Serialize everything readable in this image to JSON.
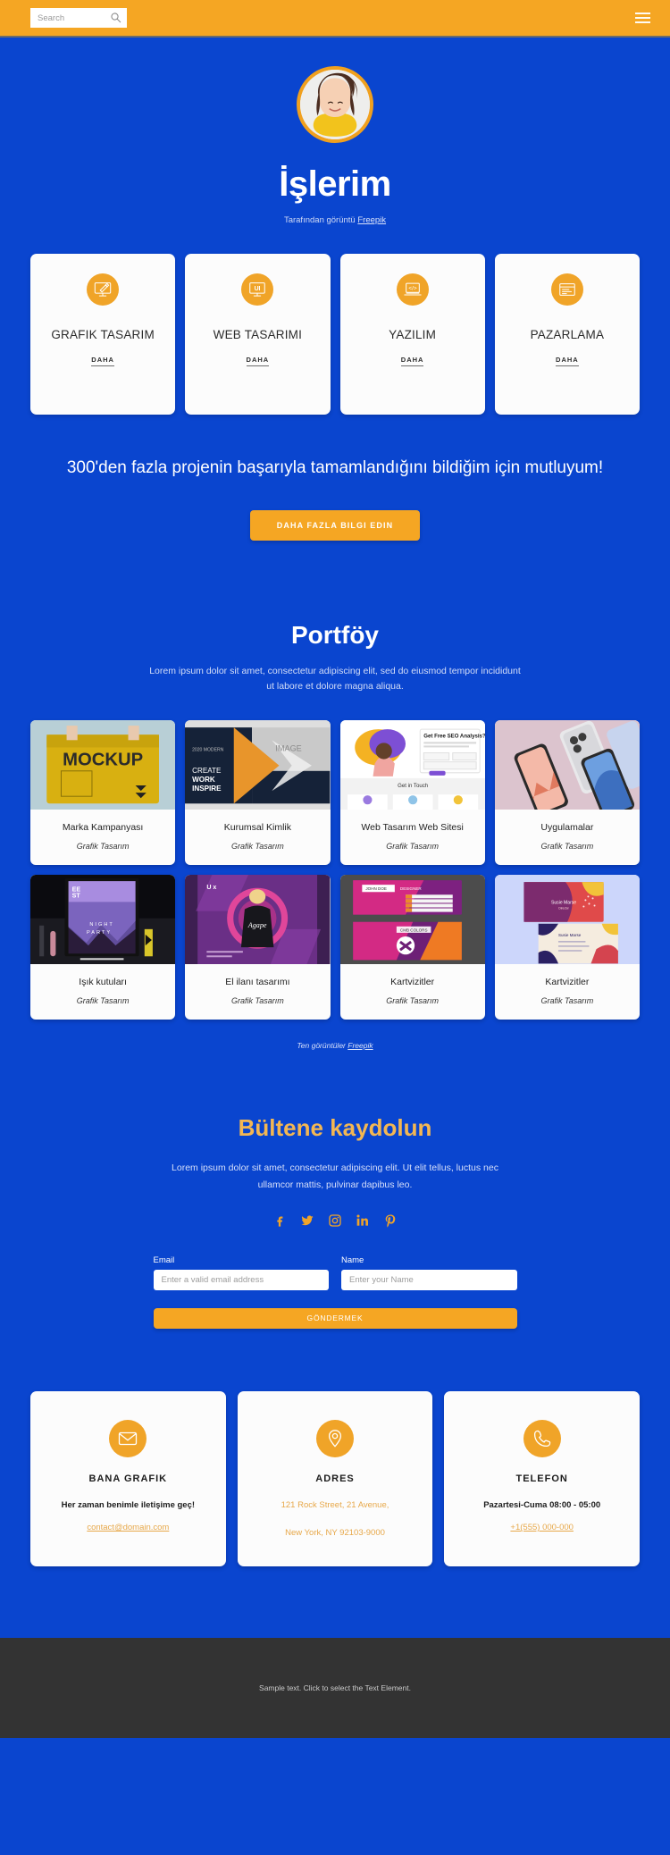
{
  "colors": {
    "brand_blue": "#0a45cf",
    "accent_orange": "#f0a428",
    "topbar_orange": "#f5a623",
    "footer_gray": "#333333",
    "newsletter_title": "#f3b753"
  },
  "topbar": {
    "search_placeholder": "Search",
    "search_value": "",
    "search_icon": "search-icon",
    "menu_icon": "hamburger-menu-icon"
  },
  "hero": {
    "avatar_alt": "profile-photo",
    "title": "İşlerim",
    "credit_prefix": "Tarafından görüntü",
    "credit_link": "Freepik"
  },
  "services": [
    {
      "icon": "monitor-brush-icon",
      "title": "GRAFIK TASARIM",
      "more": "DAHA"
    },
    {
      "icon": "monitor-ui-icon",
      "title": "WEB TASARIMI",
      "more": "DAHA"
    },
    {
      "icon": "laptop-code-icon",
      "title": "YAZILIM",
      "more": "DAHA"
    },
    {
      "icon": "browser-window-icon",
      "title": "PAZARLAMA",
      "more": "DAHA"
    }
  ],
  "cta": {
    "headline": "300'den fazla projenin başarıyla tamamlandığını bildiğim için mutluyum!",
    "button": "DAHA FAZLA BILGI EDIN"
  },
  "portfolio": {
    "title": "Portföy",
    "subtitle": "Lorem ipsum dolor sit amet, consectetur adipiscing elit, sed do eiusmod tempor incididunt ut labore et dolore magna aliqua.",
    "items": [
      {
        "name": "Marka Kampanyası",
        "category": "Grafik Tasarım",
        "thumb": "yellow-mockup-bag"
      },
      {
        "name": "Kurumsal Kimlik",
        "category": "Grafik Tasarım",
        "thumb": "corporate-brochure"
      },
      {
        "name": "Web Tasarım Web Sitesi",
        "category": "Grafik Tasarım",
        "thumb": "seo-landing-page"
      },
      {
        "name": "Uygulamalar",
        "category": "Grafik Tasarım",
        "thumb": "phone-mockups"
      },
      {
        "name": "Işık kutuları",
        "category": "Grafik Tasarım",
        "thumb": "night-party-lightbox"
      },
      {
        "name": "El ilanı tasarımı",
        "category": "Grafik Tasarım",
        "thumb": "purple-flyer"
      },
      {
        "name": "Kartvizitler",
        "category": "Grafik Tasarım",
        "thumb": "pink-business-cards"
      },
      {
        "name": "Kartvizitler",
        "category": "Grafik Tasarım",
        "thumb": "abstract-business-cards"
      }
    ],
    "credit_prefix": "Ten görüntüler",
    "credit_link": "Freepik"
  },
  "newsletter": {
    "title": "Bültene kaydolun",
    "subtitle": "Lorem ipsum dolor sit amet, consectetur adipiscing elit. Ut elit tellus, luctus nec ullamcor mattis, pulvinar dapibus leo.",
    "socials": [
      {
        "icon": "facebook-icon",
        "glyph": "f"
      },
      {
        "icon": "twitter-icon",
        "glyph": "t"
      },
      {
        "icon": "instagram-icon",
        "glyph": "i"
      },
      {
        "icon": "linkedin-icon",
        "glyph": "in"
      },
      {
        "icon": "pinterest-icon",
        "glyph": "p"
      }
    ],
    "email_label": "Email",
    "email_placeholder": "Enter a valid email address",
    "email_value": "",
    "name_label": "Name",
    "name_placeholder": "Enter your Name",
    "name_value": "",
    "submit": "GÖNDERMEK"
  },
  "contacts": [
    {
      "icon": "envelope-icon",
      "title": "BANA GRAFIK",
      "line1": "Her zaman benimle iletişime geç!",
      "link": "contact@domain.com"
    },
    {
      "icon": "map-pin-icon",
      "title": "ADRES",
      "line1": "121 Rock Street, 21 Avenue,",
      "line2": "New York, NY 92103-9000"
    },
    {
      "icon": "phone-icon",
      "title": "TELEFON",
      "line1": "Pazartesi-Cuma 08:00 - 05:00",
      "link": "+1(555) 000-000"
    }
  ],
  "footer": {
    "text": "Sample text. Click to select the Text Element."
  }
}
